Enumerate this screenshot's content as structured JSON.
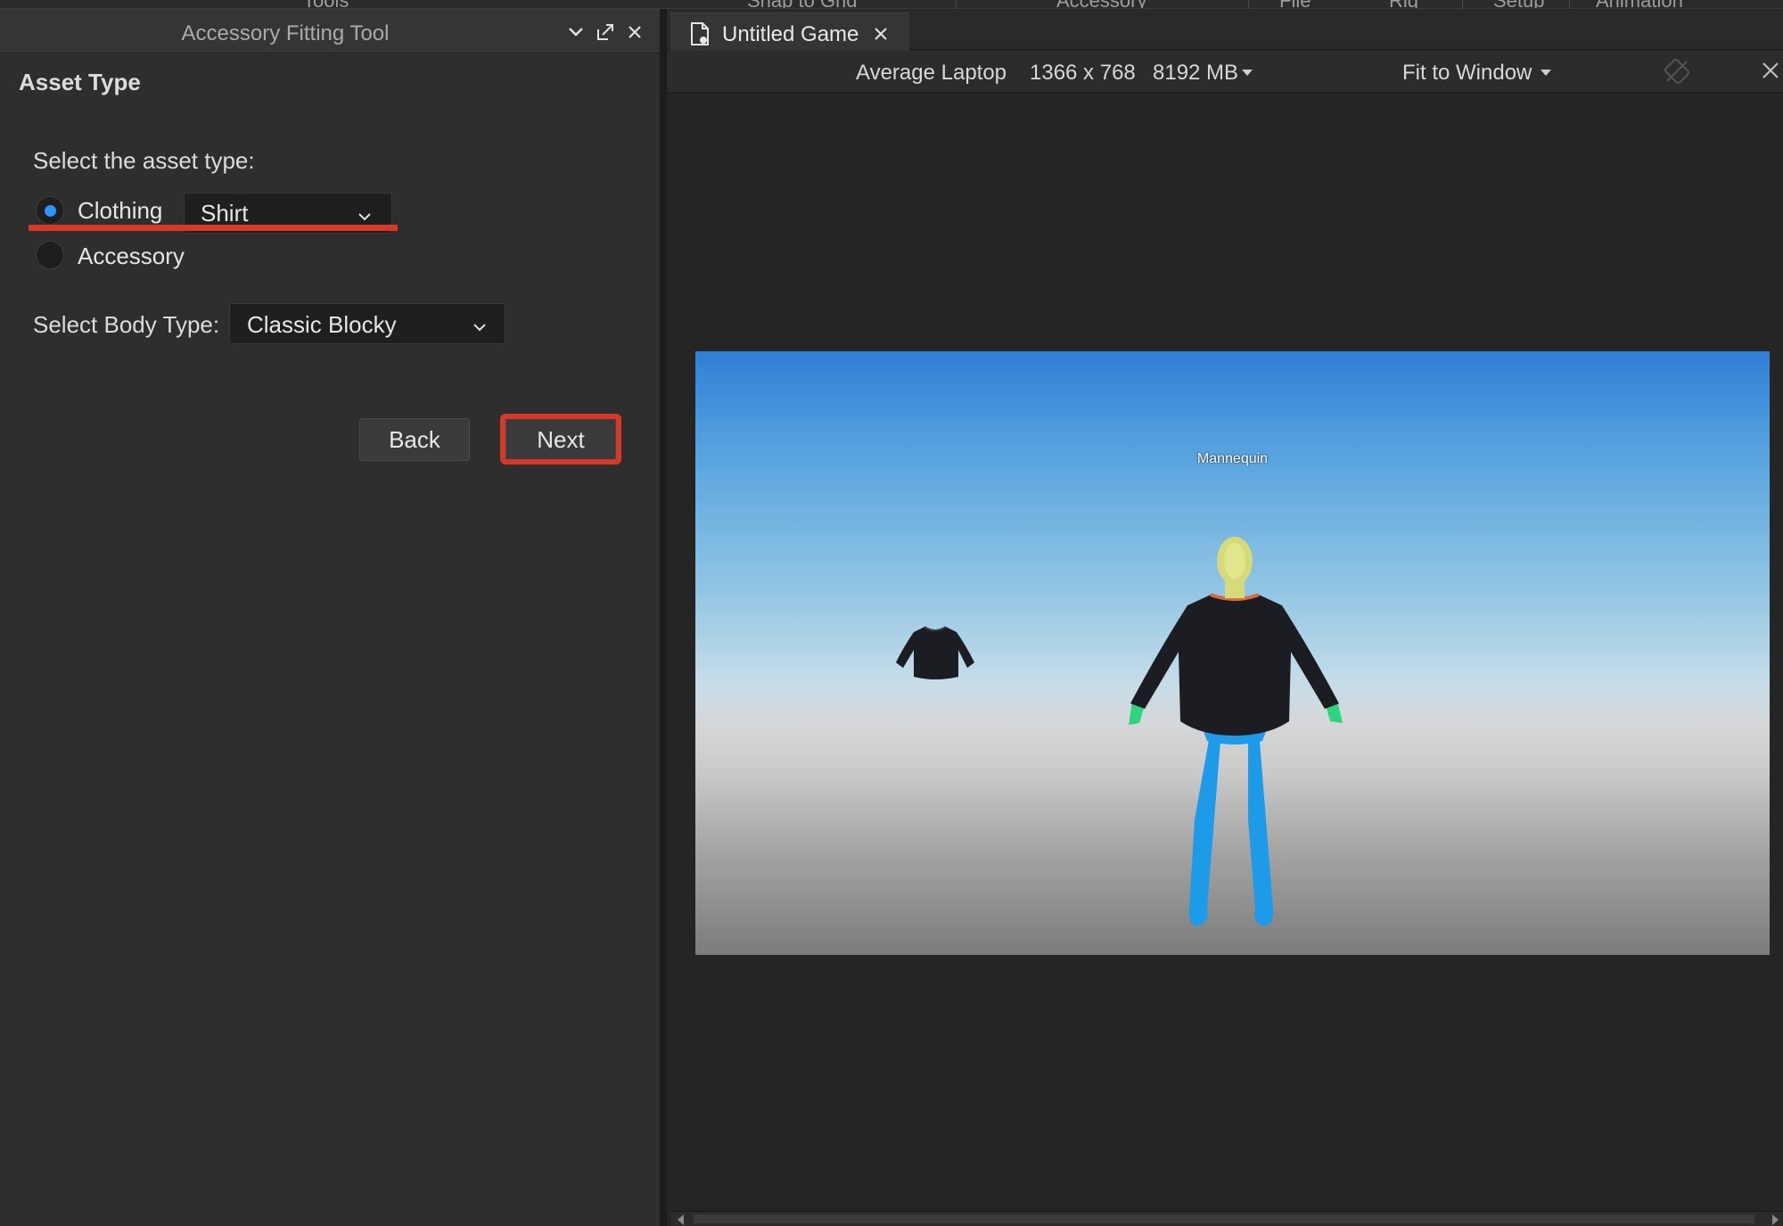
{
  "ribbon": {
    "items": [
      "Tools",
      "Snap to Grid",
      "Accessory",
      "File",
      "Rig",
      "Setup",
      "Animation"
    ]
  },
  "panel": {
    "title": "Accessory Fitting Tool",
    "section_title": "Asset Type",
    "select_asset_label": "Select the asset type:",
    "options": {
      "clothing_label": "Clothing",
      "clothing_selected": true,
      "clothing_dropdown_value": "Shirt",
      "accessory_label": "Accessory",
      "accessory_selected": false
    },
    "body_type_label": "Select Body Type:",
    "body_type_value": "Classic Blocky",
    "back_label": "Back",
    "next_label": "Next"
  },
  "editor": {
    "tab_label": "Untitled Game",
    "device": "Average Laptop",
    "resolution": "1366 x 768",
    "memory": "8192 MB",
    "fit": "Fit to Window"
  },
  "viewport": {
    "mannequin_label": "Mannequin"
  },
  "colors": {
    "accent_blue": "#2f93ff",
    "highlight_red": "#d7382a",
    "panel_bg": "#2e2e2e",
    "shirt": "#1b1d22",
    "legs": "#1e9be8",
    "head": "#d6da7a",
    "hands": "#2ed47e"
  }
}
